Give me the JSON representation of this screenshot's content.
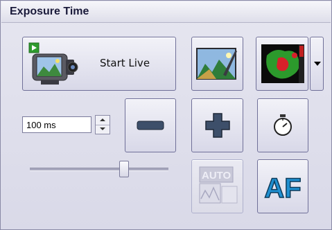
{
  "panel": {
    "title": "Exposure Time"
  },
  "start_live": {
    "label": "Start Live",
    "icon": "video-camera-icon"
  },
  "exposure": {
    "value": "100 ms"
  },
  "slider": {
    "level": 0.7
  },
  "buttons": {
    "snapshot_icon": "landscape-image-icon",
    "overlay_icon": "fluorescence-overlay-icon",
    "dropdown_icon": "chevron-down-icon",
    "decrease_icon": "minus-icon",
    "increase_icon": "plus-icon",
    "timer_icon": "stopwatch-icon",
    "auto_icon": "auto-exposure-icon",
    "auto_text": "AUTO",
    "auto_enabled": false,
    "autofocus_text": "AF"
  },
  "colors": {
    "panel_bg": "#dcdcea",
    "border": "#6f6f98",
    "af_fill": "#1f8fd0",
    "plus_minus": "#3d4f6a"
  }
}
